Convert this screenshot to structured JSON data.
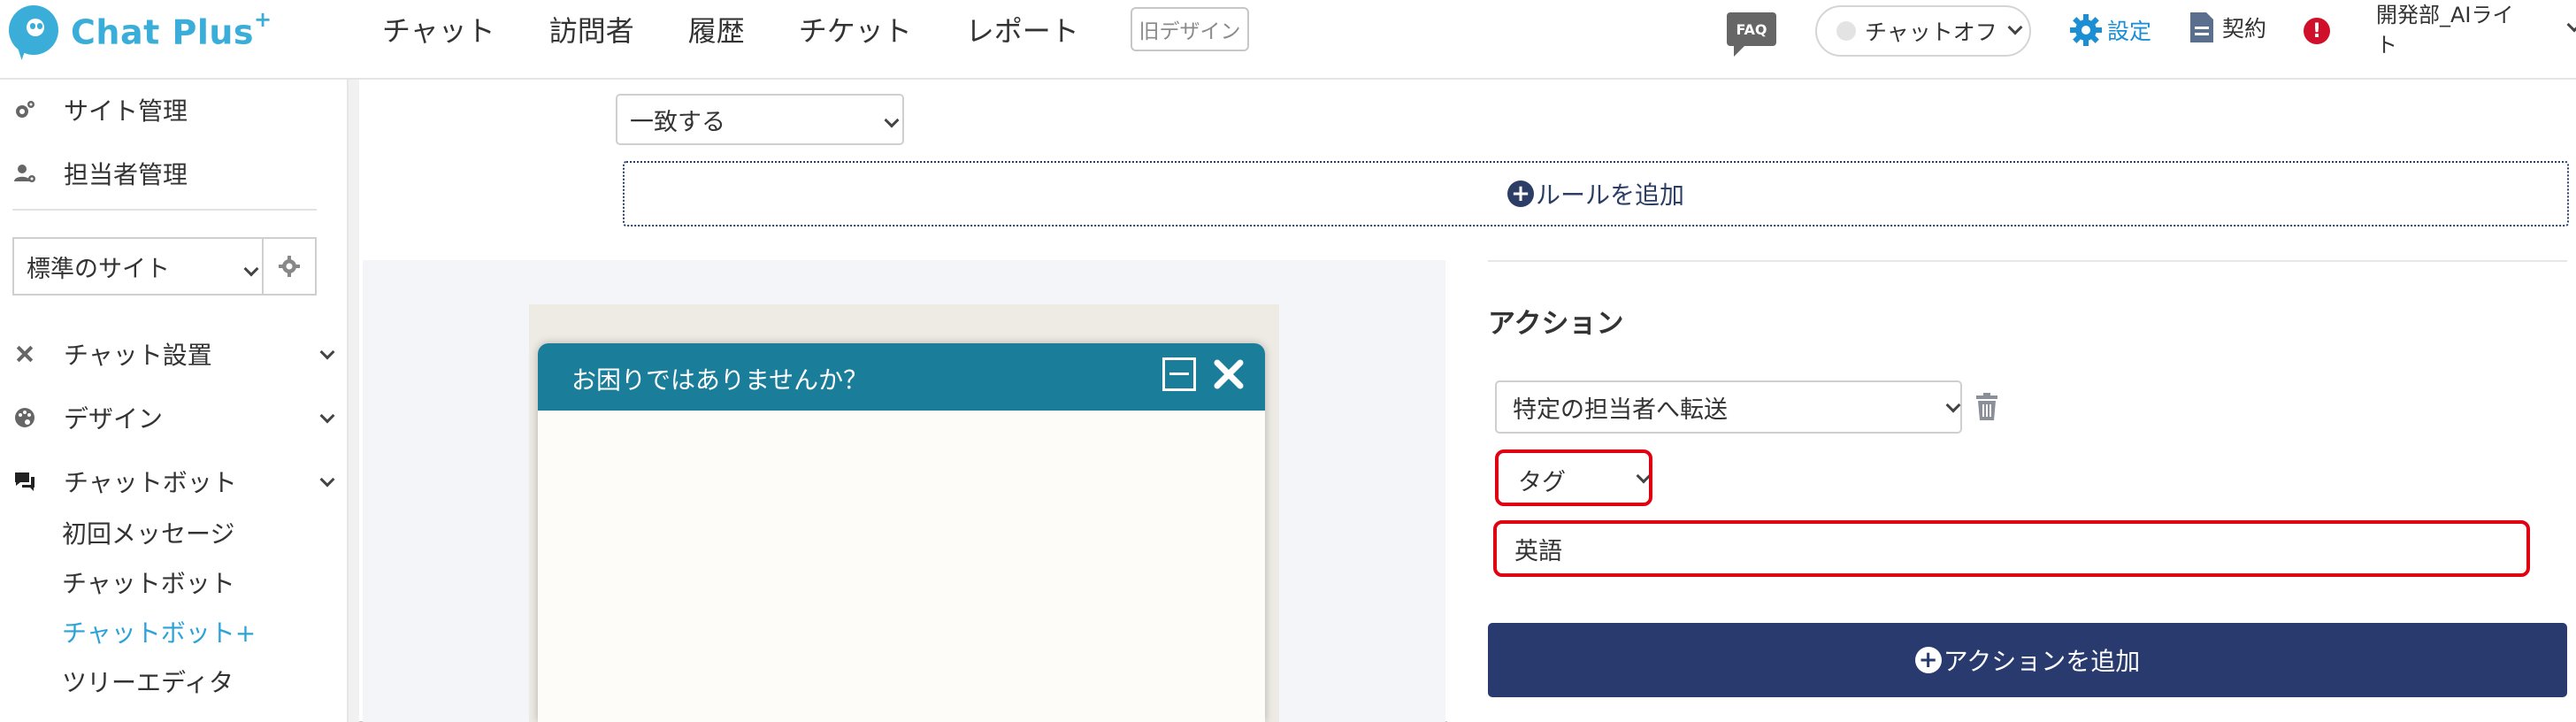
{
  "header": {
    "logo_text": "Chat Plus",
    "logo_sup": "+",
    "nav": [
      "チャット",
      "訪問者",
      "履歴",
      "チケット",
      "レポート"
    ],
    "old_design": "旧デザイン",
    "faq": "FAQ",
    "chat_status": "チャットオフ",
    "settings": "設定",
    "contract": "契約",
    "alert": "!",
    "user_line1": "開発部_AIライ",
    "user_line2": "ト"
  },
  "sidebar": {
    "site_admin": "サイト管理",
    "staff_admin": "担当者管理",
    "site_select": "標準のサイト",
    "chat_settings": "チャット設置",
    "design": "デザイン",
    "chatbot": "チャットボット",
    "sub_items": [
      "初回メッセージ",
      "チャットボット",
      "チャットボット+",
      "ツリーエディタ"
    ],
    "active_index": 2
  },
  "rule": {
    "match_select": "一致する",
    "add_rule": "ルールを追加"
  },
  "preview": {
    "widget_title": "お困りではありませんか？"
  },
  "action": {
    "title": "アクション",
    "type_select": "特定の担当者へ転送",
    "tag_select": "タグ",
    "tag_value": "英語",
    "add_action": "アクションを追加"
  },
  "colors": {
    "brand": "#3aaed8",
    "widget_header": "#1a7d99",
    "primary_button": "#283a6e",
    "highlight": "#e00012"
  }
}
